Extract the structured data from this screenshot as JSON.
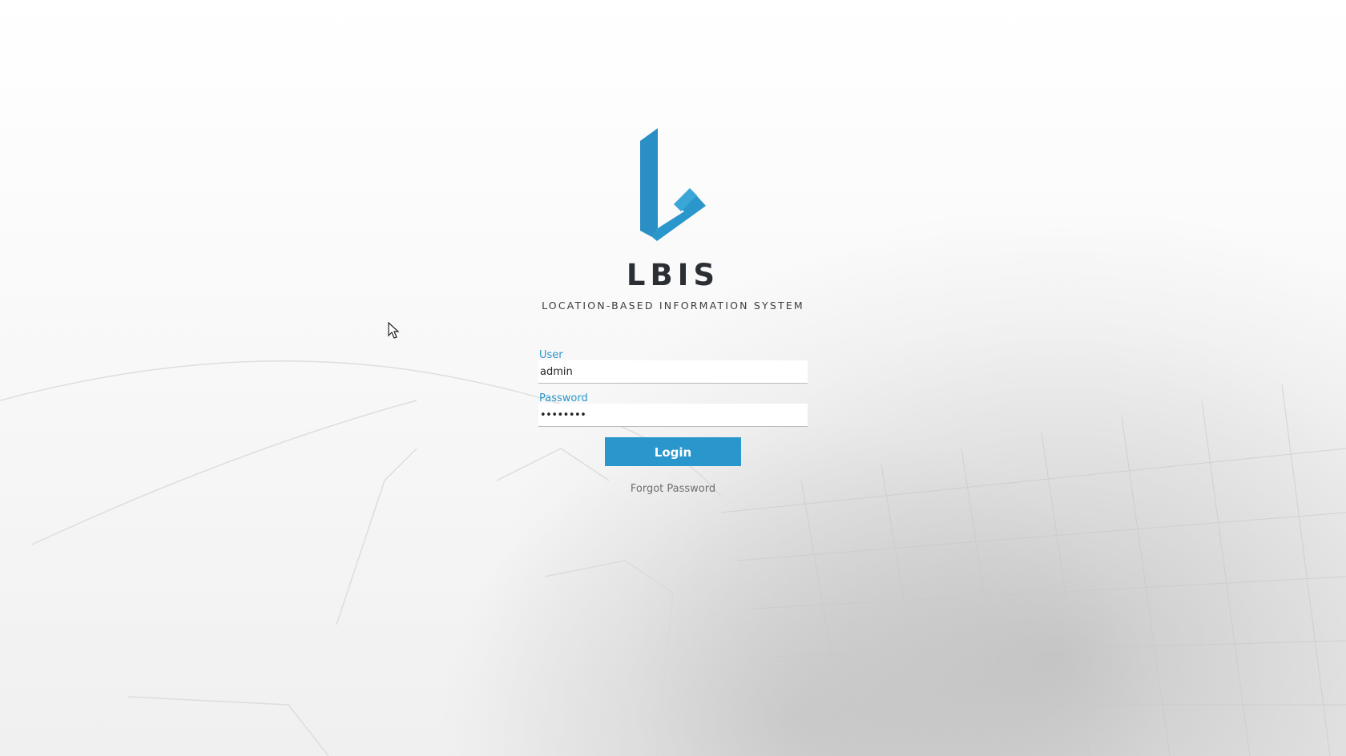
{
  "brand": {
    "name": "LBIS",
    "tagline": "LOCATION-BASED INFORMATION SYSTEM",
    "logo_icon": "lbis-logo-icon",
    "accent_color": "#2996cc"
  },
  "login_form": {
    "user_label": "User",
    "user_value": "admin",
    "password_label": "Password",
    "password_value_masked": "••••••••",
    "login_label": "Login",
    "forgot_password_label": "Forgot Password"
  },
  "background": {
    "description_icon": "aerial-city-map-background"
  },
  "pointer": {
    "icon": "mouse-cursor-icon"
  }
}
